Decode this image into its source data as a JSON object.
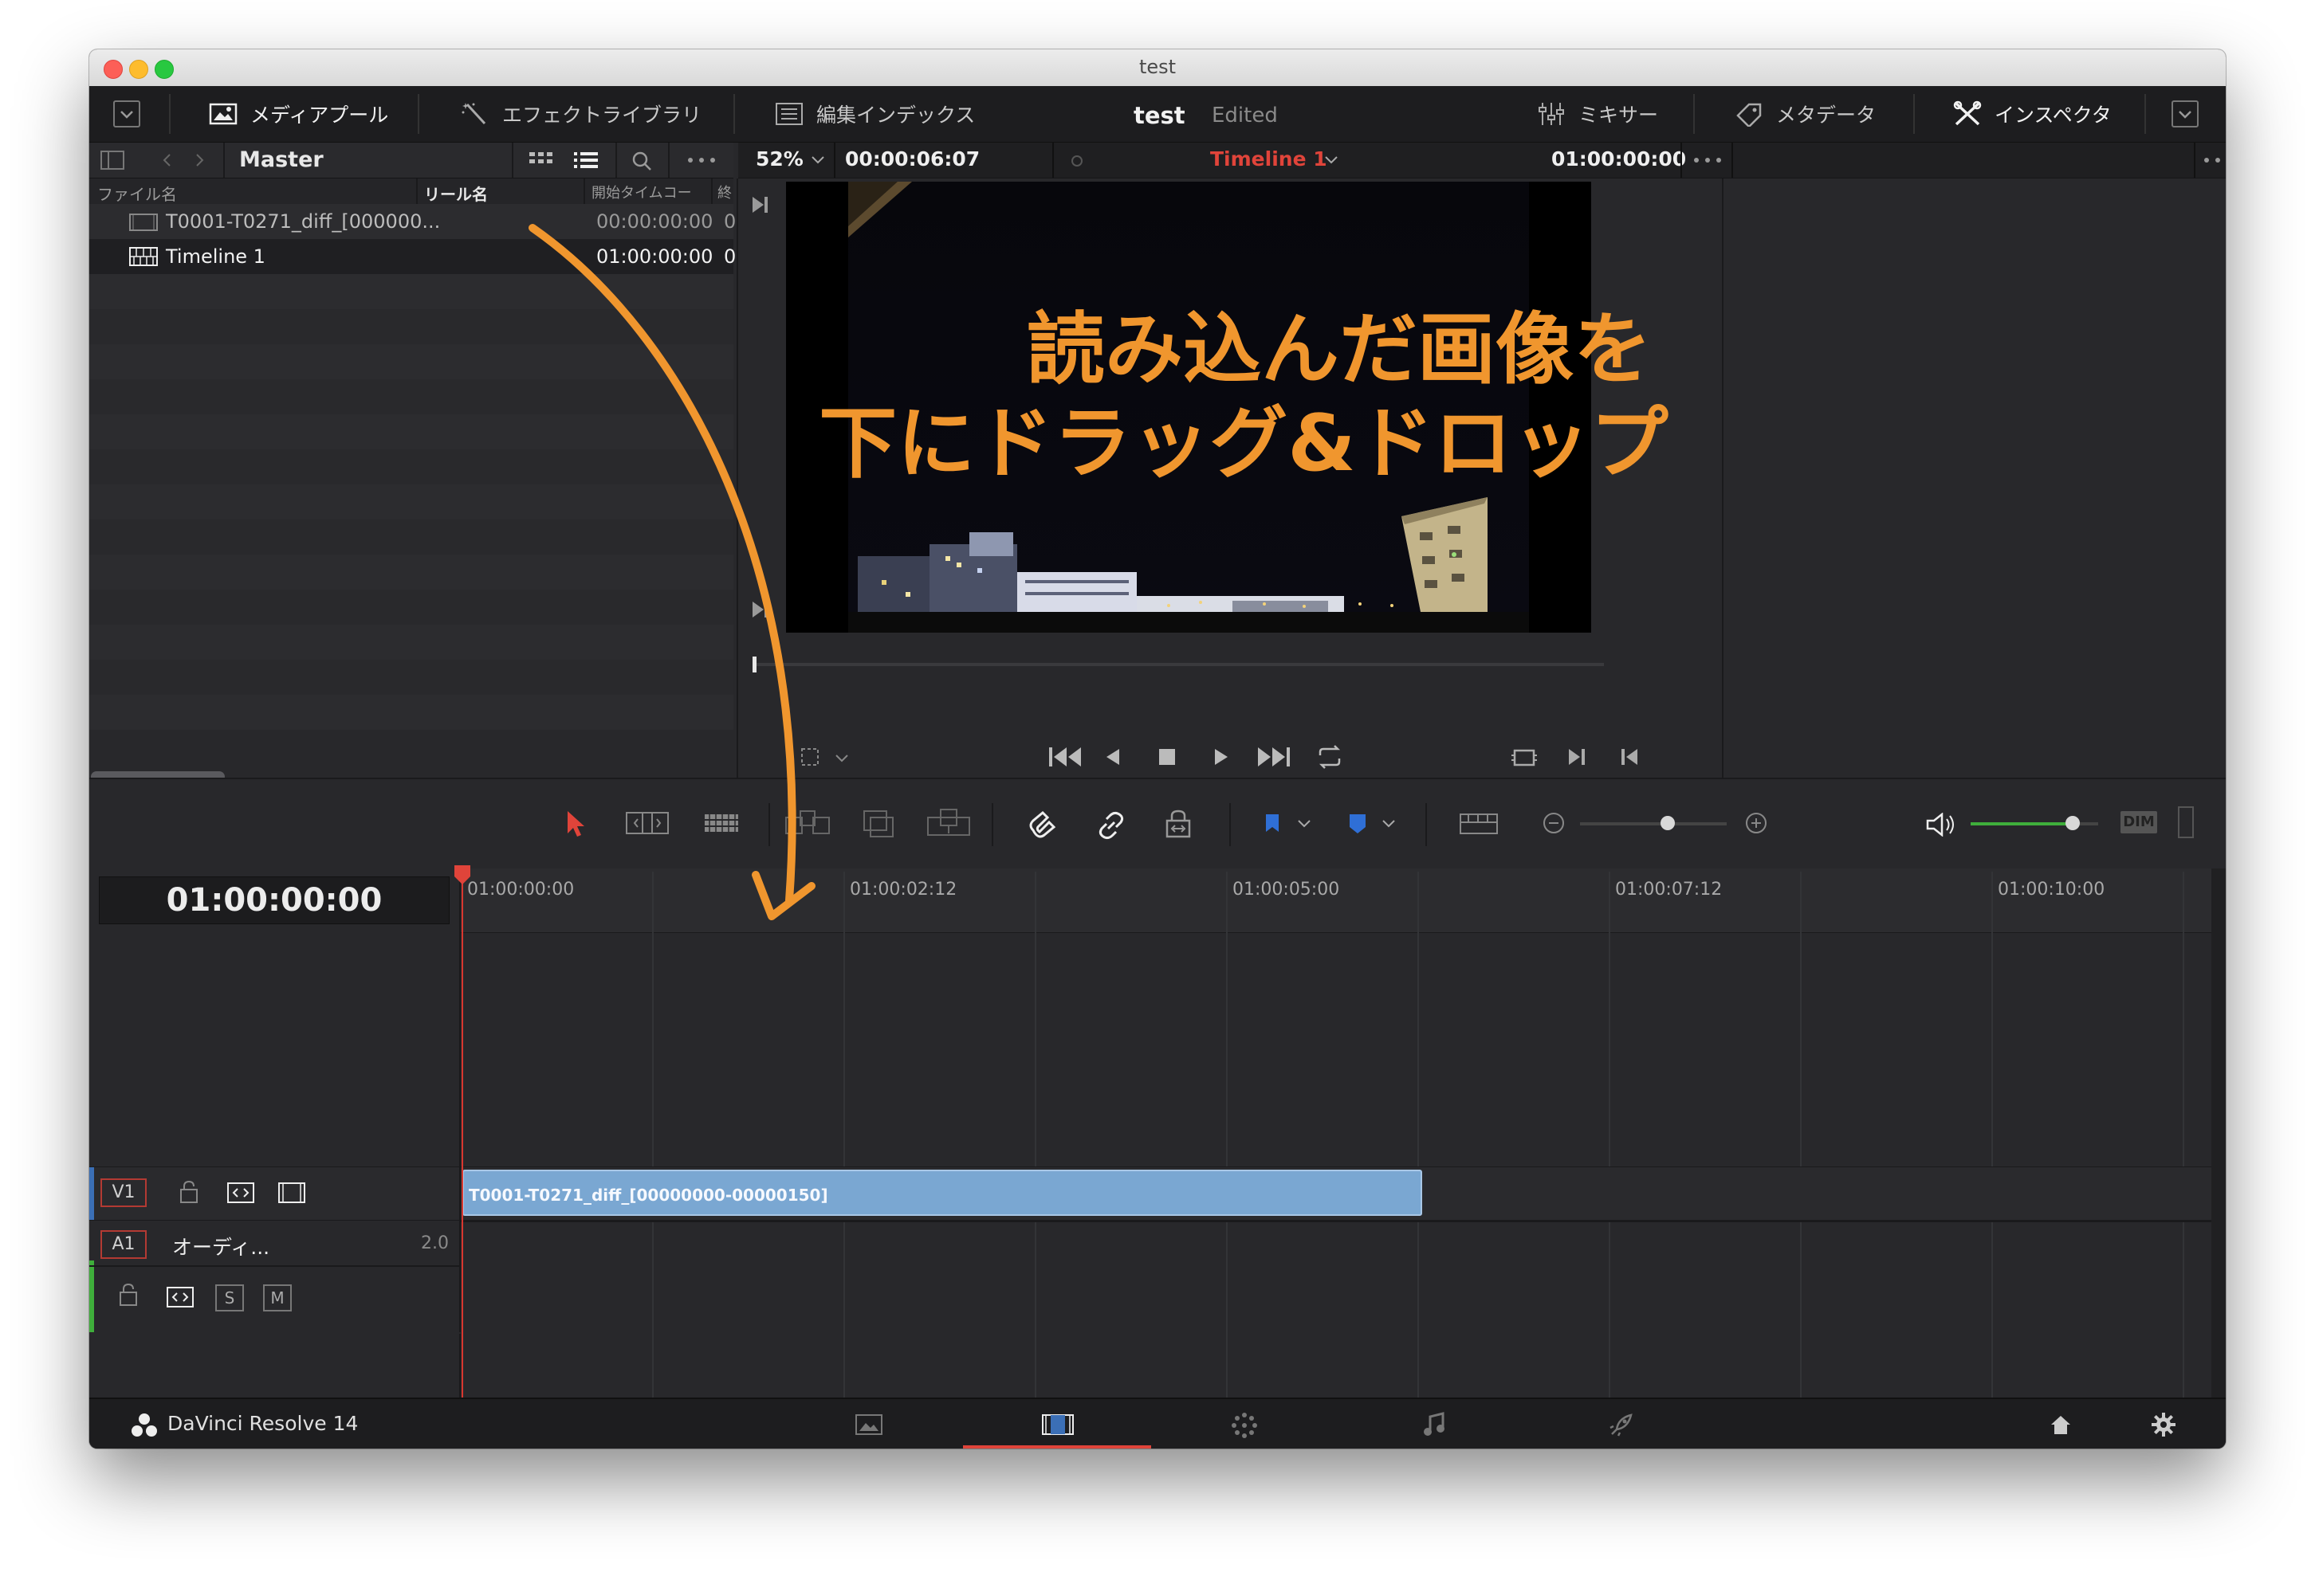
{
  "window": {
    "title": "test"
  },
  "toolbar": {
    "media_pool": "メディアプール",
    "effects_library": "エフェクトライブラリ",
    "edit_index": "編集インデックス",
    "project_name": "test",
    "project_status": "Edited",
    "mixer": "ミキサー",
    "metadata": "メタデータ",
    "inspector": "インスペクタ"
  },
  "media_pool": {
    "bin": "Master",
    "columns": [
      "ファイル名",
      "リール名",
      "開始タイムコー",
      "終"
    ],
    "items": [
      {
        "name": "T0001-T0271_diff_[000000...",
        "start_tc": "00:00:00:00",
        "extra": "0"
      },
      {
        "name": "Timeline 1",
        "start_tc": "01:00:00:00",
        "extra": "0"
      }
    ]
  },
  "viewer": {
    "zoom": "52%",
    "duration": "00:00:06:07",
    "timeline_name": "Timeline 1",
    "timecode": "01:00:00:00",
    "annotation_line1": "読み込んだ画像を",
    "annotation_line2": "下にドラッグ&ドロップ"
  },
  "edit_toolbar": {
    "dim_label": "DIM",
    "zoom_level": 0.6,
    "audio_level": 0.8
  },
  "timeline": {
    "current_tc": "01:00:00:00",
    "ruler": [
      "01:00:00:00",
      "01:00:02:12",
      "01:00:05:00",
      "01:00:07:12",
      "01:00:10:00"
    ],
    "tracks": {
      "v1": {
        "label": "V1"
      },
      "a1": {
        "label": "A1",
        "name": "オーディ...",
        "channels": "2.0",
        "solo": "S",
        "mute": "M"
      }
    },
    "clip": {
      "name": "T0001-T0271_diff_[00000000-00000150]"
    }
  },
  "footer": {
    "app_name": "DaVinci Resolve 14"
  },
  "colors": {
    "accent_orange": "#f0962e",
    "timeline_red": "#e0443a",
    "clip_blue": "#7aa7d2",
    "green_meter": "#3fae3b"
  }
}
